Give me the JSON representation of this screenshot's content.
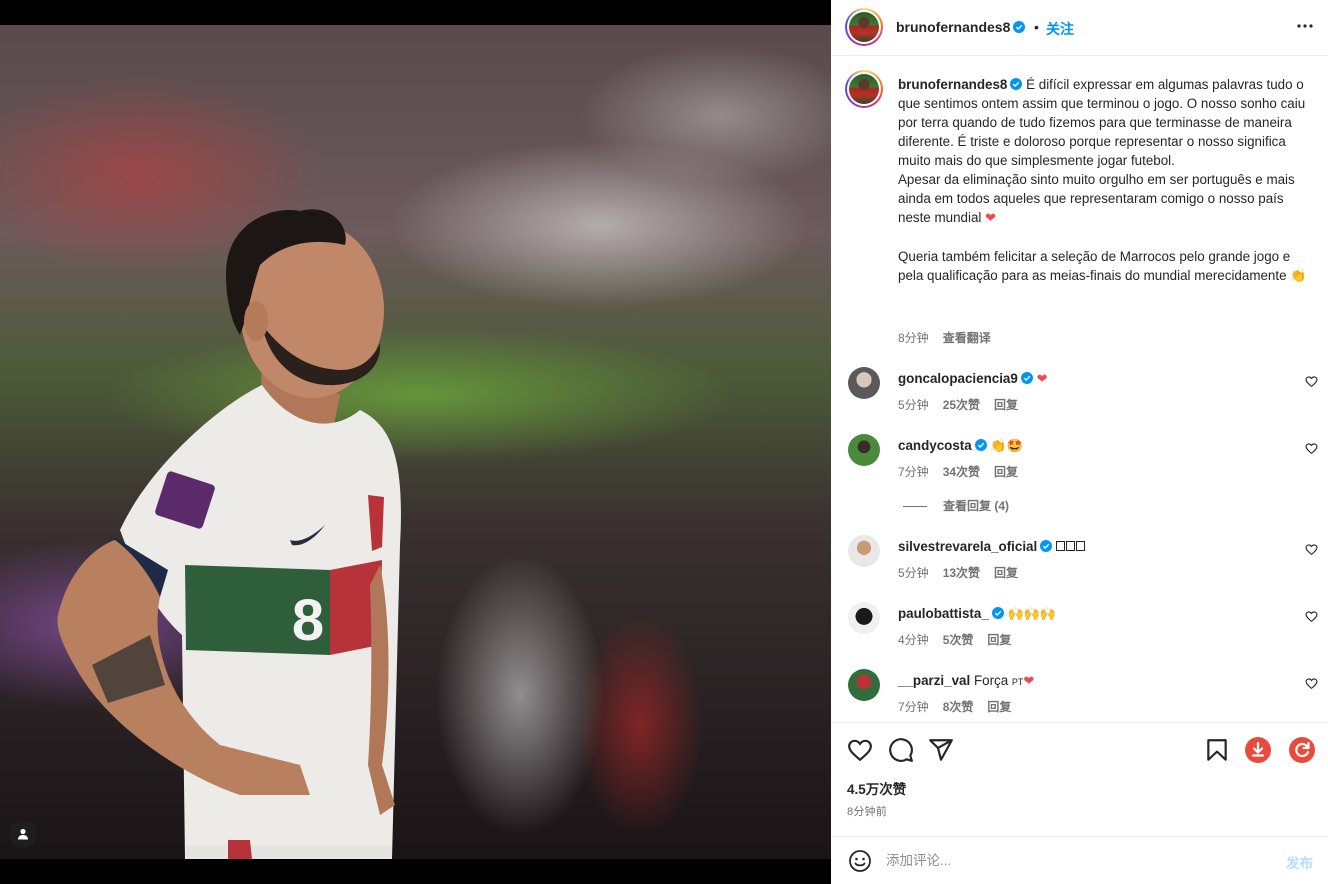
{
  "post": {
    "username": "brunofernandes8",
    "dot": "•",
    "follow_label": "关注",
    "caption_text": "É difícil expressar em algumas palavras tudo o que sentimos ontem assim que terminou o jogo. O nosso sonho caiu por terra quando de tudo fizemos para que terminasse de maneira diferente. É triste e doloroso porque representar o nosso significa muito mais do que simplesmente jogar futebol.\nApesar da eliminação sinto muito orgulho em ser português e mais ainda em todos aqueles que representaram comigo o nosso país neste mundial ",
    "caption_emoji_1": "❤",
    "caption_text_2": "Queria também felicitar a seleção de Marrocos pelo grande jogo e pela qualificação para as meias-finais do mundial merecidamente ",
    "caption_emoji_2": "👏",
    "caption_time": "8分钟",
    "caption_translate": "查看翻译",
    "likes": "4.5万次赞",
    "time_ago": "8分钟前"
  },
  "comments": [
    {
      "username": "goncalopaciencia9",
      "text": "❤",
      "time": "5分钟",
      "likes": "25次赞",
      "reply": "回复",
      "verified": true
    },
    {
      "username": "candycosta",
      "text": "👏🤩",
      "time": "7分钟",
      "likes": "34次赞",
      "reply": "回复",
      "verified": true
    },
    {
      "username": "silvestrevarela_oficial",
      "text": "",
      "time": "5分钟",
      "likes": "13次赞",
      "reply": "回复",
      "verified": true
    },
    {
      "username": "paulobattista_",
      "text": "🙌🙌🙌",
      "time": "4分钟",
      "likes": "5次赞",
      "reply": "回复",
      "verified": true
    },
    {
      "username": "__parzi_val",
      "text": "Força ",
      "text_emoji": "❤",
      "flag": "PT",
      "time": "7分钟",
      "likes": "8次赞",
      "reply": "回复",
      "verified": false
    }
  ],
  "view_replies": "查看回复 (4)",
  "composer": {
    "placeholder": "添加评论...",
    "post_label": "发布"
  },
  "media": {
    "jersey_number": "8"
  },
  "colors": {
    "link_blue": "#0095f6",
    "verified_blue": "#0095f6",
    "heart_red": "#ed4956",
    "muted_text": "#737373",
    "extension_red": "#e84b3c"
  },
  "icons": [
    "more-options-icon",
    "heart-icon",
    "comment-icon",
    "share-icon",
    "save-bookmark-icon",
    "download-extension-icon",
    "refresh-extension-icon",
    "emoji-icon",
    "user-tag-icon",
    "verified-badge-icon"
  ]
}
